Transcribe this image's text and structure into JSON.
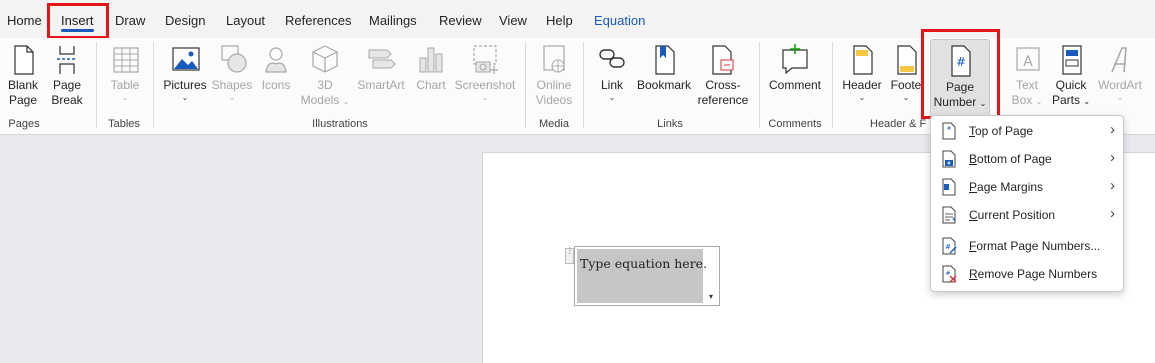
{
  "tabs": {
    "home": "Home",
    "insert": "Insert",
    "draw": "Draw",
    "design": "Design",
    "layout": "Layout",
    "references": "References",
    "mailings": "Mailings",
    "review": "Review",
    "view": "View",
    "help": "Help",
    "equation": "Equation"
  },
  "ribbon": {
    "blank_page": [
      "Blank",
      "Page"
    ],
    "page_break": [
      "Page",
      "Break"
    ],
    "table": "Table",
    "pictures": "Pictures",
    "shapes": "Shapes",
    "icons": "Icons",
    "models3d": [
      "3D",
      "Models"
    ],
    "smartart": "SmartArt",
    "chart": "Chart",
    "screenshot": "Screenshot",
    "online_videos": [
      "Online",
      "Videos"
    ],
    "link": "Link",
    "bookmark": "Bookmark",
    "cross_reference": [
      "Cross-",
      "reference"
    ],
    "comment": "Comment",
    "header": "Header",
    "footer": "Foote",
    "page_number": [
      "Page",
      "Number"
    ],
    "text_box": [
      "Text",
      "Box"
    ],
    "quick_parts": [
      "Quick",
      "Parts"
    ],
    "wordart": "WordArt",
    "caret": "⌄",
    "groups": {
      "pages": "Pages",
      "tables": "Tables",
      "illustrations": "Illustrations",
      "media": "Media",
      "links": "Links",
      "comments": "Comments",
      "header_footer": "Header & F"
    }
  },
  "equation": {
    "placeholder": "Type equation here.",
    "handle": "⋮",
    "dropdown": "▾"
  },
  "menu": {
    "arrow": "›",
    "items": [
      {
        "u": "T",
        "rest": "op of Page",
        "submenu": true
      },
      {
        "u": "B",
        "rest": "ottom of Page",
        "submenu": true
      },
      {
        "u": "P",
        "rest": "age Margins",
        "submenu": true
      },
      {
        "u": "C",
        "rest": "urrent Position",
        "submenu": true
      },
      {
        "u": "F",
        "rest": "ormat Page Numbers...",
        "submenu": false
      },
      {
        "u": "R",
        "rest": "emove Page Numbers",
        "submenu": false
      }
    ]
  },
  "colors": {
    "accent": "#185abd",
    "highlight_box": "#e3151a",
    "equation_bg": "#c6c6c6"
  }
}
